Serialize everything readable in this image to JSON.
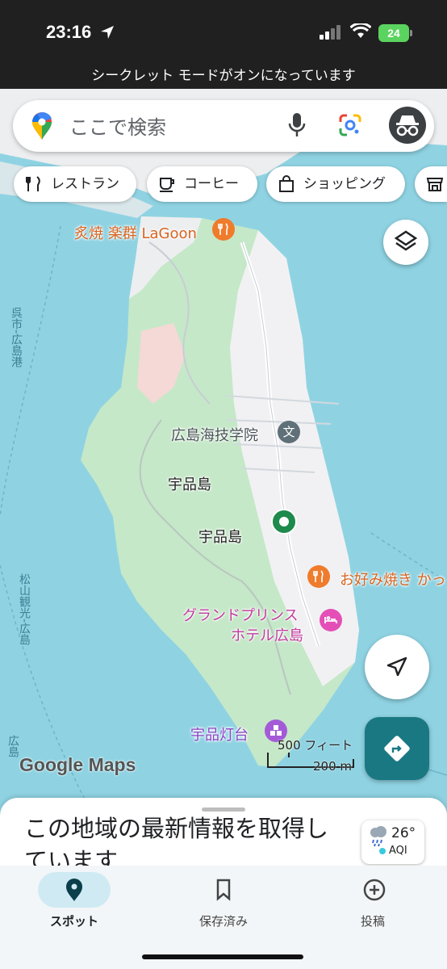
{
  "status_bar": {
    "time": "23:16",
    "battery": "24"
  },
  "incognito_banner": "シークレット モードがオンになっています",
  "search": {
    "placeholder": "ここで検索"
  },
  "chips": [
    "レストラン",
    "コーヒー",
    "ショッピング"
  ],
  "map": {
    "labels": {
      "restaurant_lagoon": "炙焼 楽群 LaGoon",
      "school": "広島海技学院",
      "island_1": "宇品島",
      "island_2": "宇品島",
      "okonomiyaki": "お好み焼き かっ",
      "hotel_line1": "グランドプリンス",
      "hotel_line2": "ホテル広島",
      "lighthouse": "宇品灯台",
      "route_left_top": "呉市-広島港",
      "route_left_mid": "松山観光-広島",
      "route_left_bottom": "広島"
    },
    "scale_ft": "500 フィート",
    "scale_m": "200 m",
    "logo": "Google Maps"
  },
  "sheet": {
    "title": "この地域の最新情報を取得しています…",
    "temp": "26°",
    "aqi": "AQI"
  },
  "nav": {
    "explore": "スポット",
    "saved": "保存済み",
    "contribute": "投稿"
  },
  "colors": {
    "water": "#8fd3e3",
    "park": "#c5e8c8",
    "urban": "#f1f1f3",
    "accent": "#1a7883",
    "poi_food": "#ef7b2c",
    "poi_hotel": "#e34fb7",
    "poi_school": "#5f7078",
    "poi_sight": "#a45ad8"
  }
}
